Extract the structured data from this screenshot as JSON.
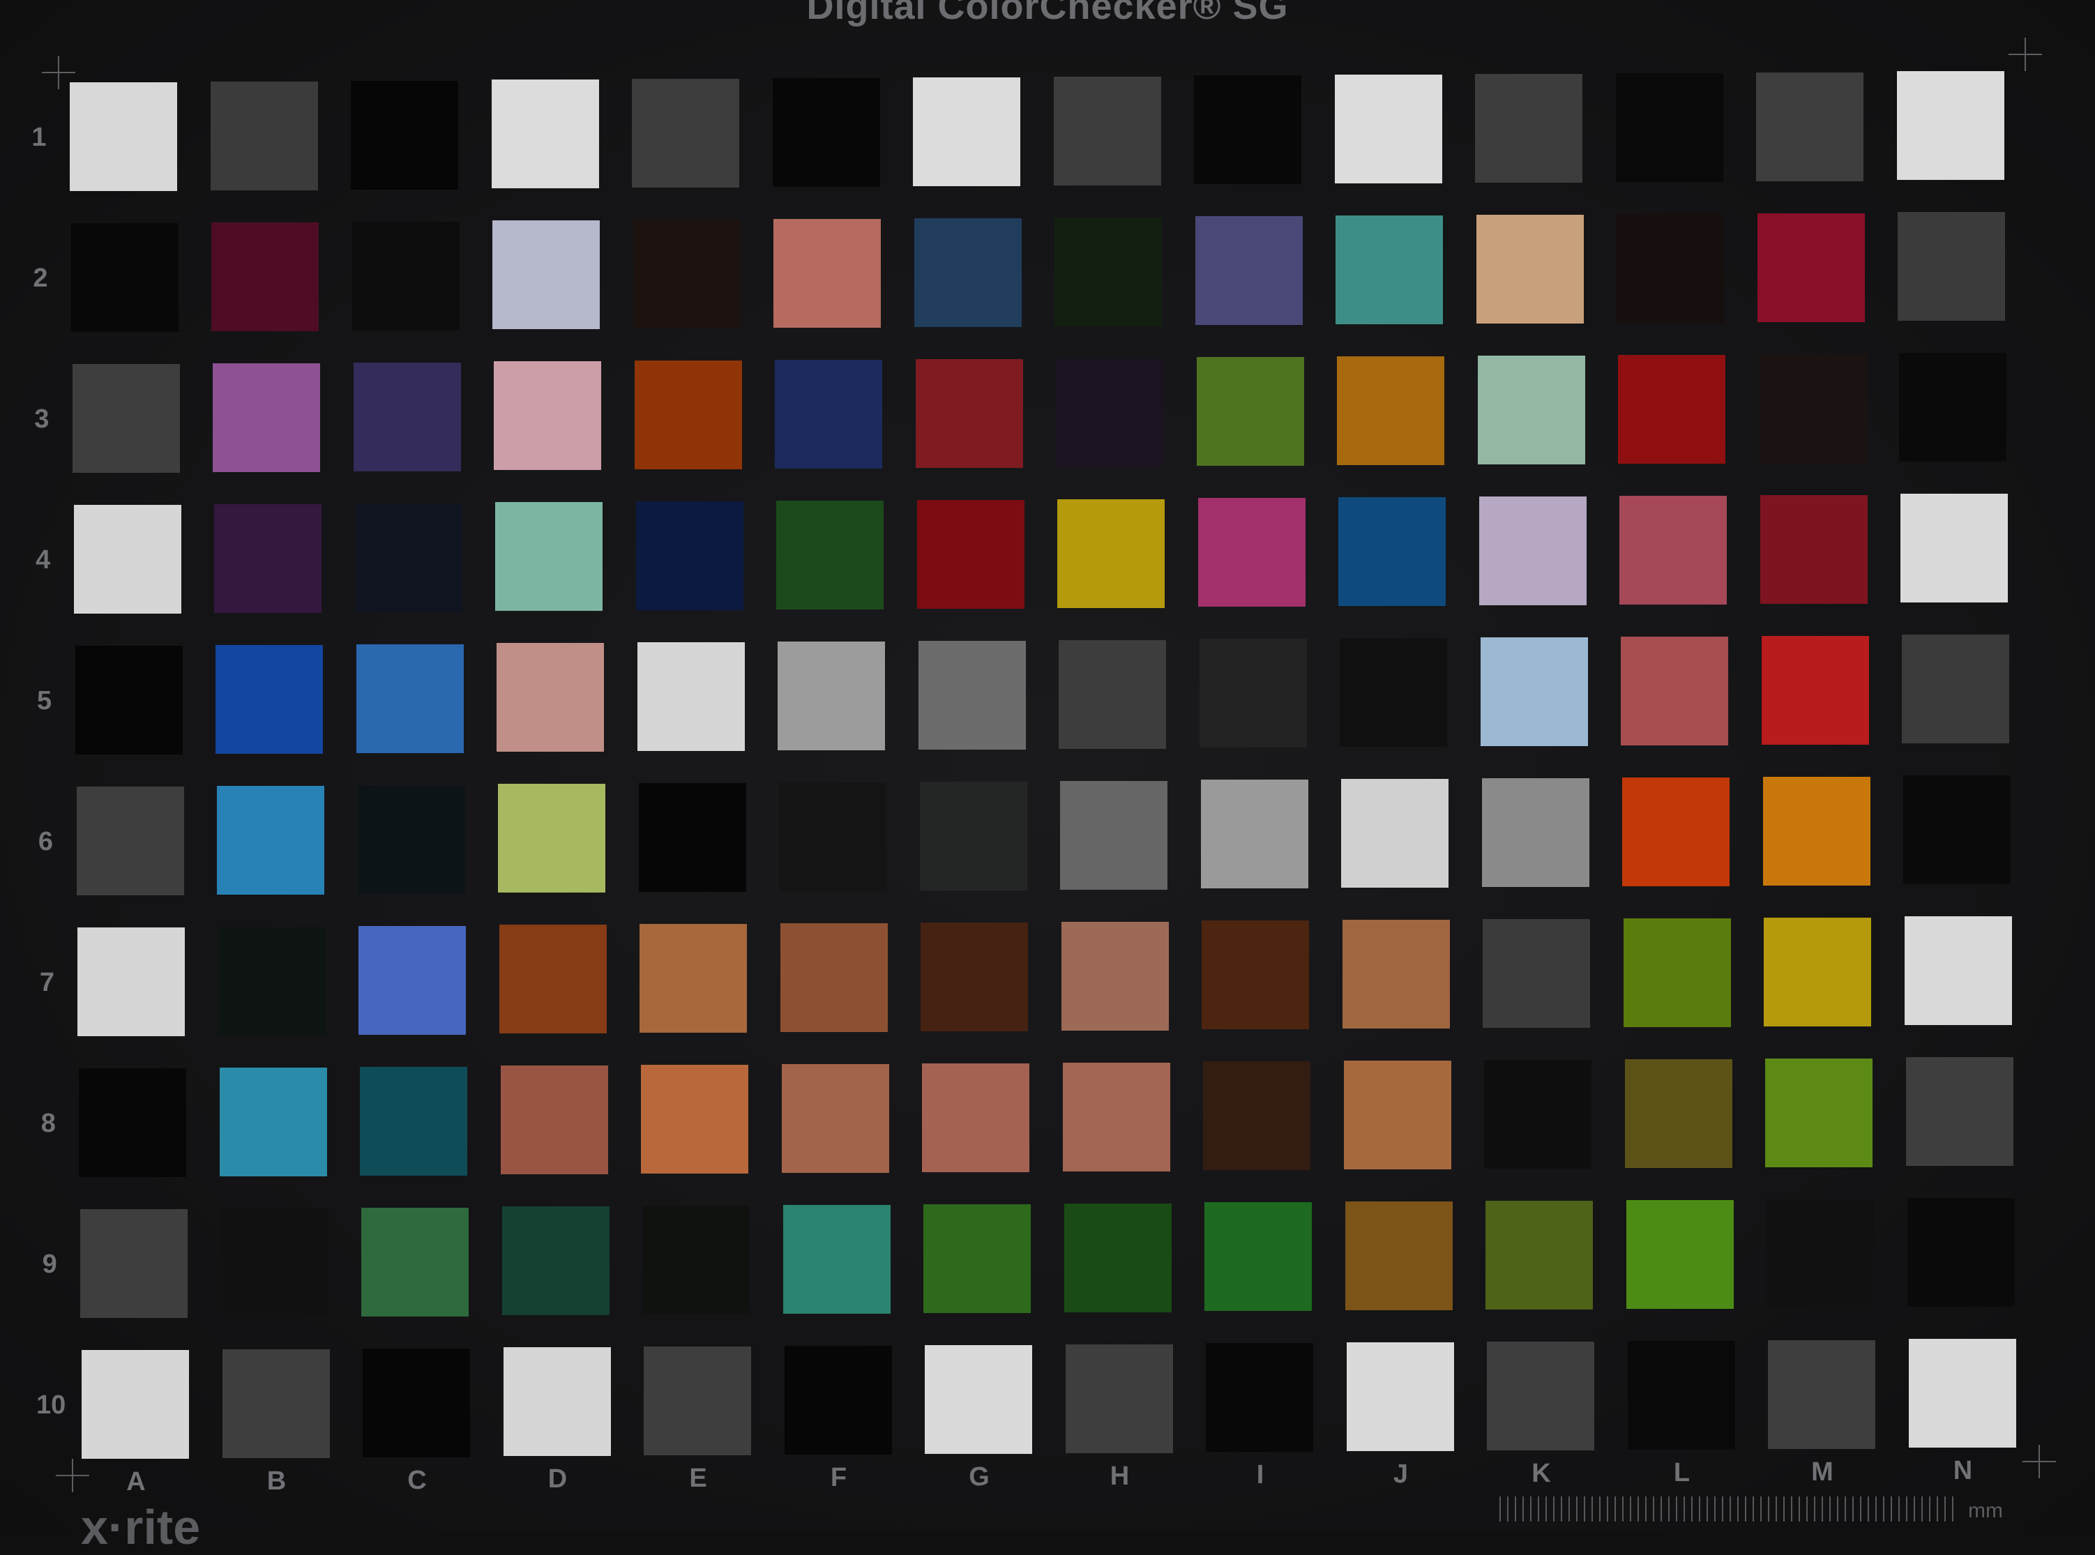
{
  "chart": {
    "title": "Digital ColorChecker® SG",
    "brand": "x·rite",
    "ruler_unit": "mm",
    "columns": [
      "A",
      "B",
      "C",
      "D",
      "E",
      "F",
      "G",
      "H",
      "I",
      "J",
      "K",
      "L",
      "M",
      "N"
    ],
    "rows": [
      "1",
      "2",
      "3",
      "4",
      "5",
      "6",
      "7",
      "8",
      "9",
      "10"
    ],
    "patch_colors": [
      [
        "#d8d8d8",
        "#3a3b3a",
        "#060606",
        "#dcdcdc",
        "#3b3c3b",
        "#070707",
        "#dcdcdc",
        "#3c3d3c",
        "#080808",
        "#dcdcdc",
        "#3c3d3c",
        "#090909",
        "#3d3e3d",
        "#dcdcdc"
      ],
      [
        "#080809",
        "#4f0c24",
        "#0c0c0c",
        "#b6b8cc",
        "#1c1310",
        "#b56b60",
        "#203d5c",
        "#13200f",
        "#4a4878",
        "#3e8e88",
        "#c9a07c",
        "#170e0e",
        "#8a0f28",
        "#3a3b3a"
      ],
      [
        "#3d3e3d",
        "#8e5294",
        "#342c5a",
        "#cc9ea8",
        "#903508",
        "#1c2a5e",
        "#7e1c22",
        "#1b1420",
        "#4e7420",
        "#a86a0e",
        "#92b8a4",
        "#900f10",
        "#1b1212",
        "#0a0a0a"
      ],
      [
        "#d6d6d6",
        "#34183e",
        "#0f1420",
        "#7cb6a2",
        "#0c1a42",
        "#1c4a1c",
        "#7c0c12",
        "#b49a0c",
        "#a2306a",
        "#0e4a7e",
        "#b6a8c2",
        "#a64858",
        "#7e1420",
        "#dadada"
      ],
      [
        "#060606",
        "#1246a0",
        "#2a68b0",
        "#c09088",
        "#d6d6d6",
        "#9c9c9c",
        "#6c6c6c",
        "#3c3d3c",
        "#222222",
        "#101010",
        "#9cb8d2",
        "#a84e50",
        "#b81c1c",
        "#3a3b3a"
      ],
      [
        "#3d3e3d",
        "#2882b6",
        "#0c1418",
        "#a6b860",
        "#060606",
        "#141414",
        "#242626",
        "#666666",
        "#9a9a9a",
        "#d0d0d0",
        "#8a8a8a",
        "#c23808",
        "#c8780a",
        "#0a0a0a"
      ],
      [
        "#d6d6d6",
        "#0e1412",
        "#4666c0",
        "#863c14",
        "#a8683c",
        "#8e5032",
        "#452212",
        "#9e6a58",
        "#4c2410",
        "#a06640",
        "#3a3b3a",
        "#5a7c0c",
        "#b49a0c",
        "#dadada"
      ],
      [
        "#070707",
        "#2a8ca8",
        "#0e4c58",
        "#9a5444",
        "#b8683a",
        "#a2644a",
        "#a46252",
        "#a46654",
        "#331c12",
        "#a8683e",
        "#0e0e0e",
        "#5c5218",
        "#5c8a14",
        "#3d3e3d"
      ],
      [
        "#3d3e3d",
        "#111111",
        "#2e6a3c",
        "#144032",
        "#101210",
        "#2a8470",
        "#2e6a1c",
        "#1a4a16",
        "#1e6a20",
        "#7c5418",
        "#4e6218",
        "#4c8c14",
        "#111111",
        "#0a0a0a"
      ],
      [
        "#d6d6d6",
        "#3d3e3d",
        "#060606",
        "#d6d6d6",
        "#3d3e3d",
        "#060606",
        "#dadada",
        "#3d3e3d",
        "#080808",
        "#dadada",
        "#3d3e3d",
        "#090909",
        "#3d3e3d",
        "#dadada"
      ]
    ]
  }
}
